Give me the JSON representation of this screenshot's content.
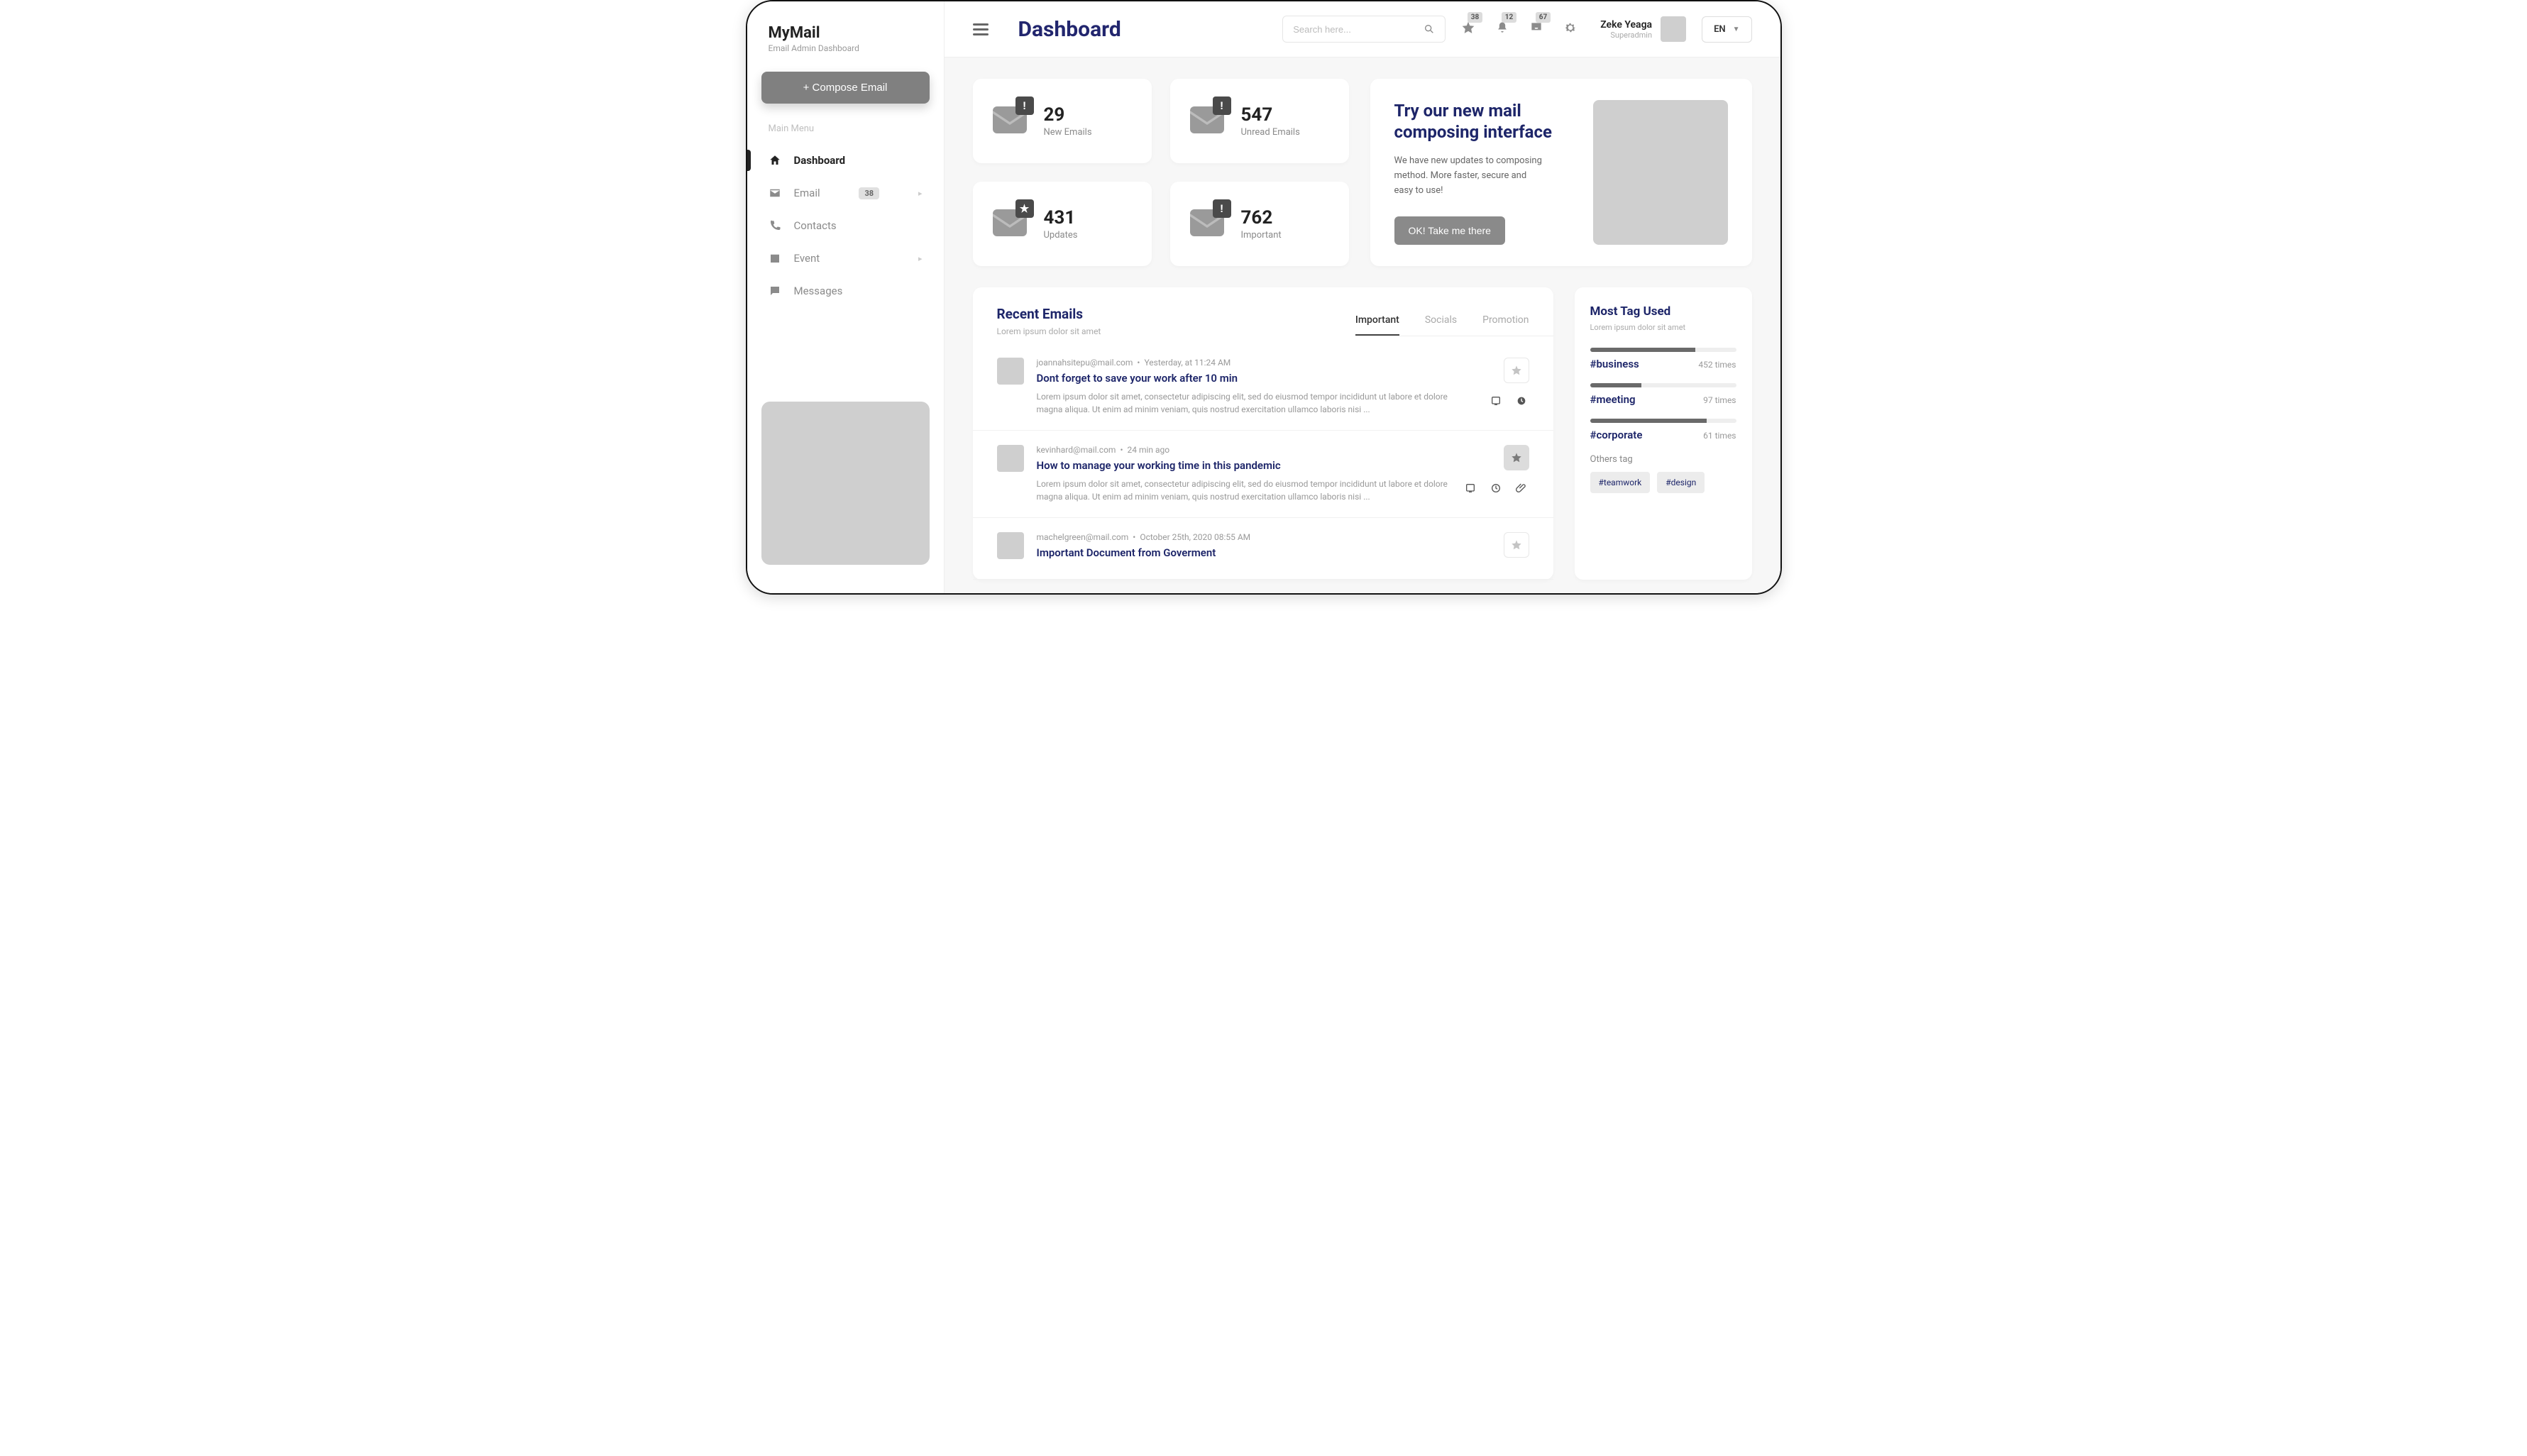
{
  "brand": {
    "title": "MyMail",
    "subtitle": "Email Admin Dashboard"
  },
  "compose_label": "+ Compose Email",
  "menu_label": "Main Menu",
  "nav": [
    {
      "label": "Dashboard",
      "icon": "home",
      "active": true
    },
    {
      "label": "Email",
      "icon": "mail",
      "badge": "38",
      "chevron": true
    },
    {
      "label": "Contacts",
      "icon": "phone"
    },
    {
      "label": "Event",
      "icon": "calendar",
      "chevron": true
    },
    {
      "label": "Messages",
      "icon": "chat"
    }
  ],
  "header": {
    "page_title": "Dashboard",
    "search_placeholder": "Search here...",
    "badges": {
      "star": "38",
      "bell": "12",
      "inbox": "67"
    },
    "user_name": "Zeke Yeaga",
    "user_role": "Superadmin",
    "lang": "EN"
  },
  "stats": [
    {
      "value": "29",
      "label": "New Emails",
      "overlay": "!"
    },
    {
      "value": "547",
      "label": "Unread Emails",
      "overlay": "!"
    },
    {
      "value": "431",
      "label": "Updates",
      "overlay": "★"
    },
    {
      "value": "762",
      "label": "Important",
      "overlay": "!"
    }
  ],
  "promo": {
    "title": "Try our new mail composing interface",
    "desc": "We have new updates to composing method. More faster, secure and easy to use!",
    "cta": "OK! Take me there"
  },
  "recent": {
    "title": "Recent Emails",
    "subtitle": "Lorem ipsum dolor sit amet",
    "tabs": [
      "Important",
      "Socials",
      "Promotion"
    ],
    "active_tab": 0,
    "emails": [
      {
        "from": "joannahsitepu@mail.com",
        "time": "Yesterday, at 11:24 AM",
        "subject": "Dont forget to save your work after 10 min",
        "preview": "Lorem ipsum dolor sit amet, consectetur adipiscing elit, sed do eiusmod tempor incididunt ut labore et dolore magna aliqua. Ut enim ad minim veniam, quis nostrud exercitation ullamco laboris nisi ...",
        "starred": false,
        "attachments": [
          "device",
          "clock"
        ]
      },
      {
        "from": "kevinhard@mail.com",
        "time": "24 min ago",
        "subject": "How to manage your working time in this pandemic",
        "preview": "Lorem ipsum dolor sit amet, consectetur adipiscing elit, sed do eiusmod tempor incididunt ut labore et dolore magna aliqua. Ut enim ad minim veniam, quis nostrud exercitation ullamco laboris nisi ...",
        "starred": true,
        "attachments": [
          "device",
          "clock",
          "clip"
        ]
      },
      {
        "from": "machelgreen@mail.com",
        "time": "October 25th, 2020  08:55 AM",
        "subject": "Important Document from Goverment",
        "preview": "",
        "starred": false,
        "attachments": []
      }
    ]
  },
  "tags": {
    "title": "Most Tag Used",
    "subtitle": "Lorem ipsum dolor sit amet",
    "items": [
      {
        "name": "#business",
        "count": "452 times",
        "pct": 72
      },
      {
        "name": "#meeting",
        "count": "97 times",
        "pct": 35
      },
      {
        "name": "#corporate",
        "count": "61 times",
        "pct": 80
      }
    ],
    "others_label": "Others tag",
    "chips": [
      "#teamwork",
      "#design"
    ]
  }
}
